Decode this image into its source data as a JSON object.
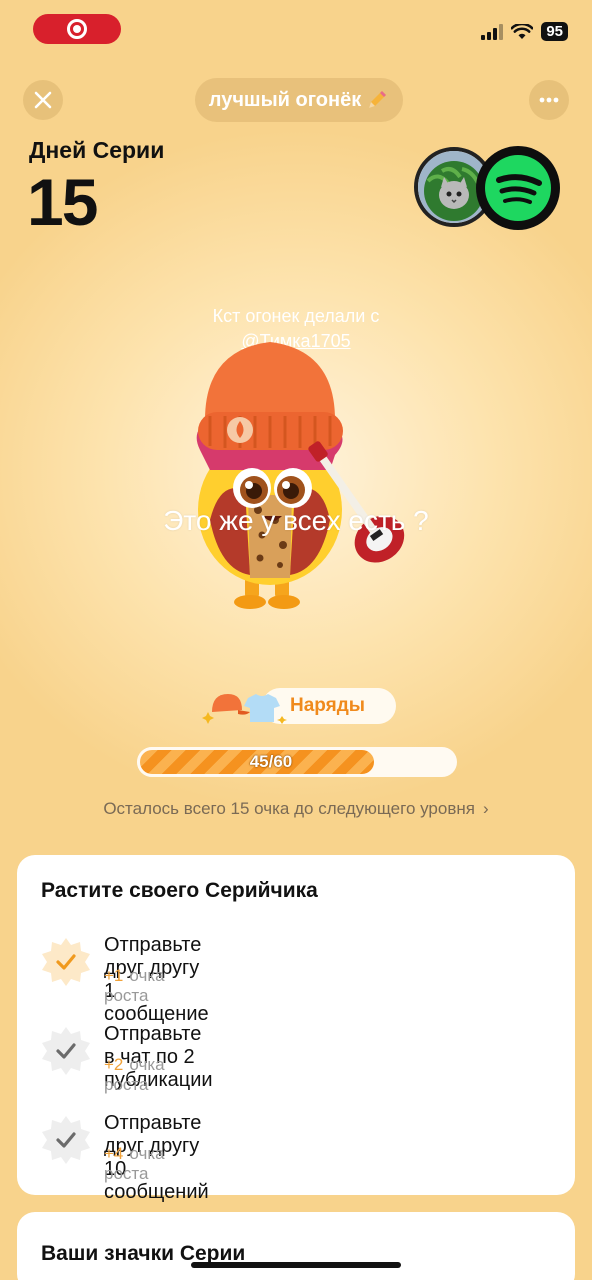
{
  "status_bar": {
    "battery": "95"
  },
  "header": {
    "title": "лучшый огонёк",
    "edit_icon": "pencil-icon",
    "close_icon": "close-icon",
    "more_icon": "more-dots-icon"
  },
  "streak": {
    "label": "Дней Серии",
    "count": "15"
  },
  "overlay": {
    "caption_line1": "Кст огонек делали с",
    "mention": "@Тимка1705",
    "big_caption": "Это же у всех есть ?"
  },
  "outfits": {
    "label": "Наряды"
  },
  "progress": {
    "text": "45/60",
    "current": 45,
    "max": 60
  },
  "remaining_text": "Осталось всего 15 очка до следующего уровня",
  "grow_card": {
    "title": "Растите своего Серийчика",
    "tasks": [
      {
        "title": "Отправьте друг другу 1 сообщение",
        "points": "+1",
        "unit": "очка роста",
        "done": true
      },
      {
        "title": "Отправьте в чат по 2 публикации",
        "points": "+2",
        "unit": "очка роста",
        "done": false
      },
      {
        "title": "Отправьте друг другу 10 сообщений",
        "points": "+4",
        "unit": "очка роста",
        "done": false
      }
    ]
  },
  "badges_card": {
    "title": "Ваши значки Серии"
  },
  "colors": {
    "accent": "#f5921f",
    "record": "#d8202c",
    "background": "#f9d690"
  }
}
